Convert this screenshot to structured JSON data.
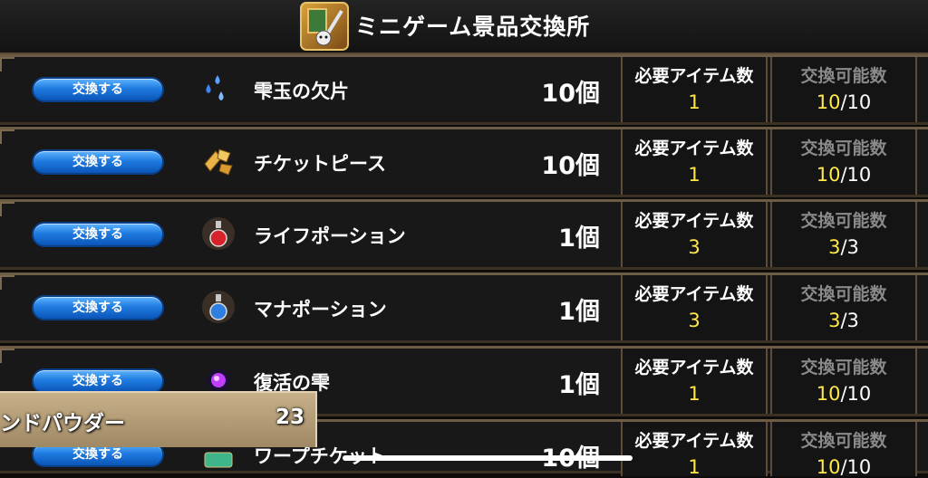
{
  "header": {
    "title": "ミニゲーム景品交換所",
    "icon": "minigame-emblem-icon"
  },
  "labels": {
    "required": "必要アイテム数",
    "exchangeable": "交換可能数"
  },
  "items": [
    {
      "button": "交換する",
      "name": "雫玉の欠片",
      "qty": "10個",
      "required": "1",
      "available": "10",
      "max": "/10",
      "icon": "droplet-shards-icon"
    },
    {
      "button": "交換する",
      "name": "チケットピース",
      "qty": "10個",
      "required": "1",
      "available": "10",
      "max": "/10",
      "icon": "ticket-piece-icon"
    },
    {
      "button": "交換する",
      "name": "ライフポーション",
      "qty": "1個",
      "required": "3",
      "available": "3",
      "max": "/3",
      "icon": "red-potion-icon"
    },
    {
      "button": "交換する",
      "name": "マナポーション",
      "qty": "1個",
      "required": "3",
      "available": "3",
      "max": "/3",
      "icon": "blue-potion-icon"
    },
    {
      "button": "交換する",
      "name": "復活の雫",
      "qty": "1個",
      "required": "1",
      "available": "10",
      "max": "/10",
      "icon": "purple-orb-icon"
    },
    {
      "button": "交換する",
      "name": "ワープチケット",
      "qty": "10個",
      "required": "1",
      "available": "10",
      "max": "/10",
      "icon": "warp-ticket-icon"
    }
  ],
  "toast": {
    "name": "ンドパウダー",
    "count": "23"
  },
  "colors": {
    "button": "#1f7be0",
    "highlight": "#ffe84a",
    "frame": "#6c5b45"
  }
}
